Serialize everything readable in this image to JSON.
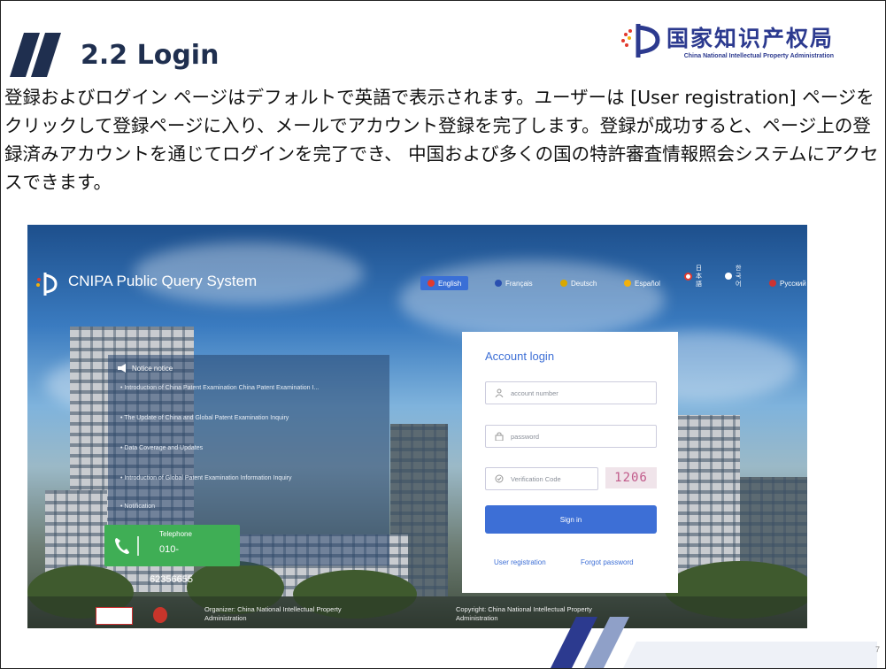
{
  "slide": {
    "title": "2.2 Login",
    "body": "登録およびログイン ページはデフォルトで英語で表示されます。ユーザーは [User registration] ページをクリックして登録ページに入り、メールでアカウント登録を完了します。登録が成功すると、ページ上の登録済みアカウントを通じてログインを完了でき、 中国および多くの国の特許審査情報照会システムにアクセスできます。",
    "page_number": "7"
  },
  "logo": {
    "cn": "国家知识产权局",
    "en": "China National Intellectual Property Administration"
  },
  "screenshot": {
    "app_name": "CNIPA  Public Query System",
    "languages": [
      "English",
      "Français",
      "Deutsch",
      "Español"
    ],
    "lang_small_1": [
      "日",
      "本",
      "語"
    ],
    "lang_small_2": [
      "한",
      "국",
      "어"
    ],
    "lang_last": "Русский",
    "notice": {
      "heading": "Notice notice",
      "items": [
        "Introduction of China Patent Examination China Patent Examination I...",
        "The Update of China and Global Patent Examination Inquiry",
        "Data Coverage and Updates",
        "Introduction of Global Patent Examination Information Inquiry",
        "Notification"
      ]
    },
    "phone": {
      "label": "Telephone",
      "number": "010-",
      "extra": "62356655"
    },
    "login": {
      "title": "Account login",
      "account_placeholder": "account number",
      "password_placeholder": "password",
      "code_placeholder": "Verification Code",
      "captcha": "1206",
      "signin": "Sign in",
      "register": "User registration",
      "forgot": "Forgot password"
    },
    "footer": {
      "organizer": "Organizer:  China National Intellectual Property",
      "organizer_2": "Administration",
      "copyright": "Copyright:  China National Intellectual Property",
      "copyright_2": "Administration"
    }
  },
  "colors": {
    "title": "#1f2f4f",
    "accent_blue": "#3d6fd6",
    "logo_blue": "#2c3a8f",
    "phone_green": "#3fae55"
  }
}
